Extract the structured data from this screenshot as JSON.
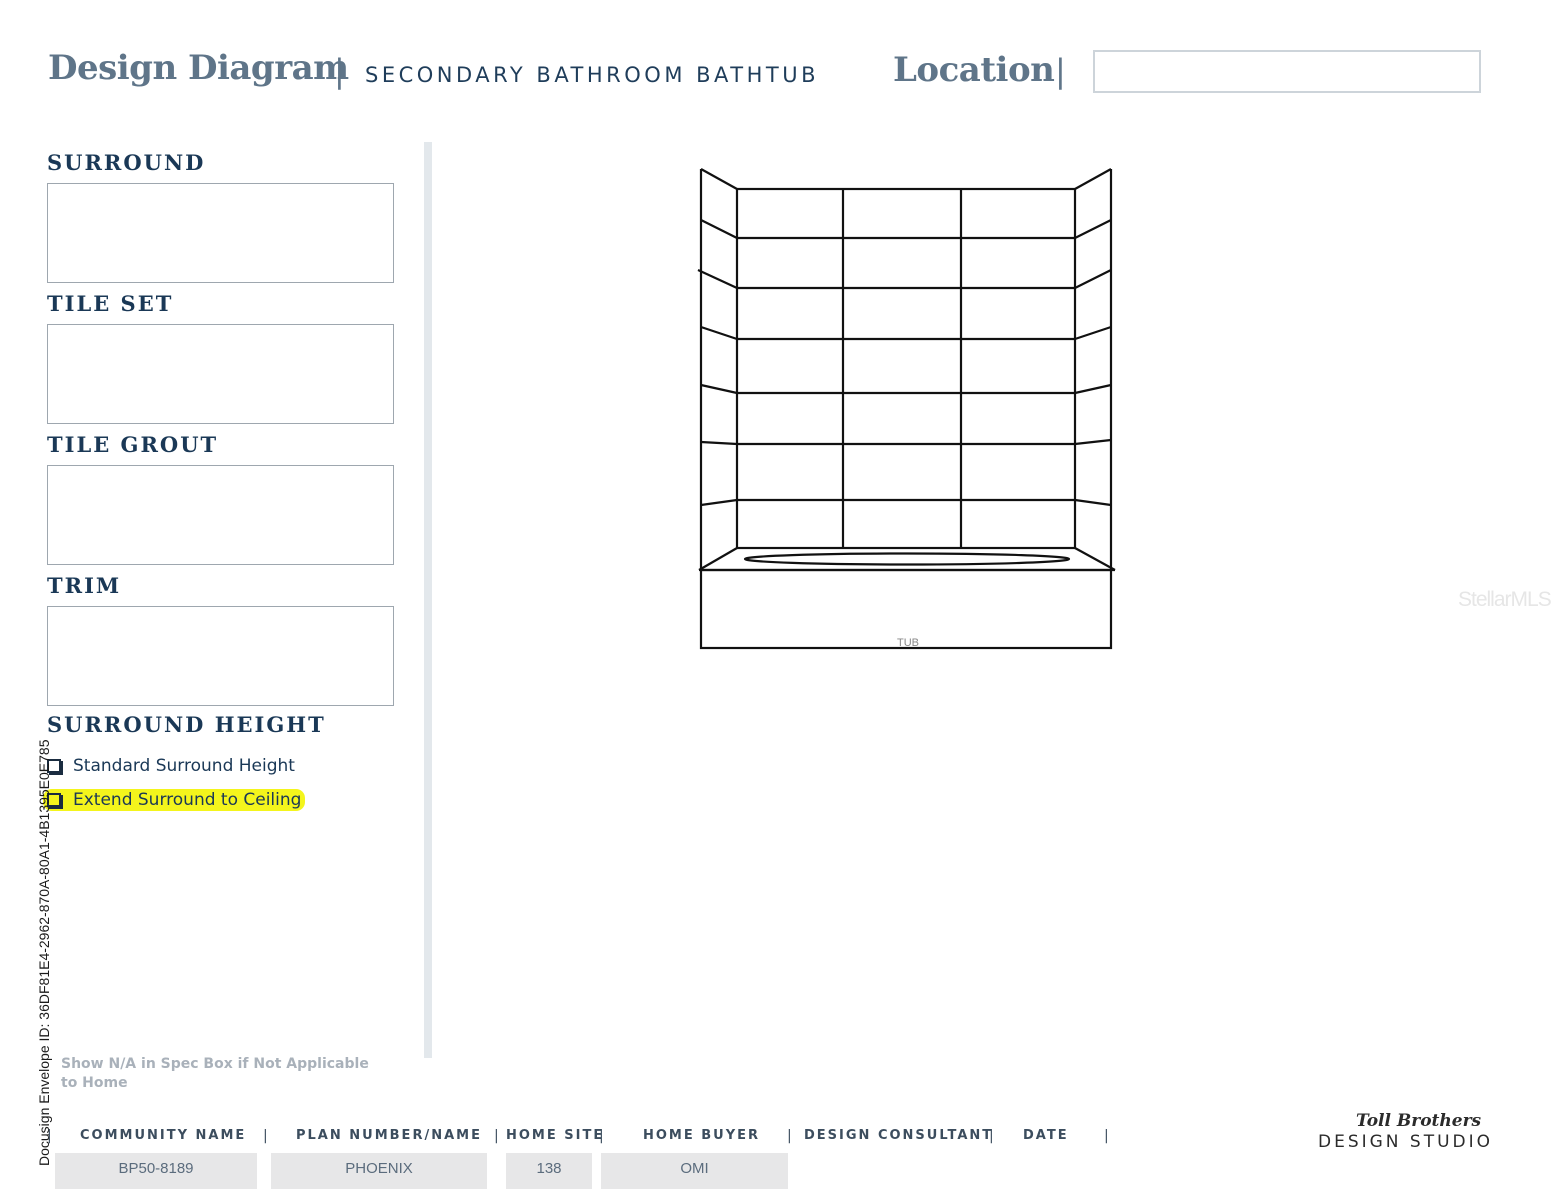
{
  "header": {
    "title": "Design Diagram",
    "subtitle": "SECONDARY BATHROOM BATHTUB",
    "location_label": "Location",
    "location_value": ""
  },
  "sections": {
    "surround": "SURROUND",
    "tile_set": "TILE SET",
    "tile_grout": "TILE GROUT",
    "trim": "TRIM",
    "surround_height": "SURROUND HEIGHT"
  },
  "options": {
    "standard": "Standard  Surround Height",
    "extend": "Extend Surround to Ceiling"
  },
  "diagram": {
    "tub_label": "TUB"
  },
  "note": "Show N/A in Spec Box if Not Applicable to Home",
  "docusign": "Docusign Envelope ID: 36DF81E4-2962-870A-80A1-4B1395E0E785",
  "watermark": "StellarMLS",
  "footer": {
    "labels": {
      "community": "COMMUNITY NAME",
      "plan": "PLAN NUMBER/NAME",
      "site": "HOME SITE",
      "buyer": "HOME BUYER",
      "consultant": "DESIGN CONSULTANT",
      "date": "DATE"
    },
    "values": {
      "community": "BP50-8189",
      "plan": "PHOENIX",
      "site": "138",
      "buyer": "OMI"
    }
  },
  "brand": {
    "name": "Toll Brothers",
    "sub": "DESIGN STUDIO"
  }
}
